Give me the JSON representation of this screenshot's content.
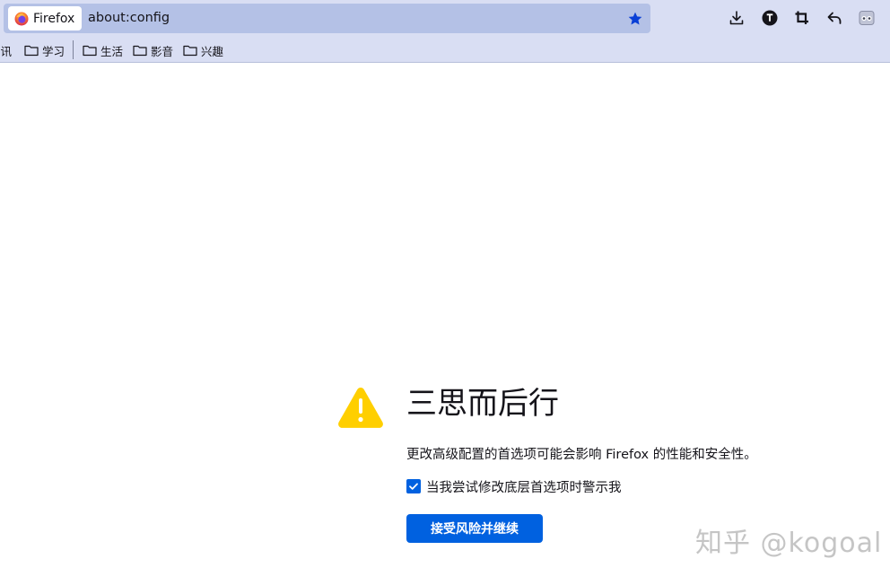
{
  "toolbar": {
    "identity_label": "Firefox",
    "url": "about:config",
    "icons": {
      "browser_logo": "firefox-logo-icon",
      "bookmark_star": "star-filled-icon",
      "downloads": "download-icon",
      "account": "account-t-icon",
      "crop": "crop-icon",
      "undo": "undo-arrow-icon",
      "extension": "extension-icon"
    },
    "colors": {
      "toolbar_bg": "#d9def3",
      "urlbar_bg": "#b4c1e6",
      "star": "#0a3fd6"
    }
  },
  "bookmarks": {
    "items": [
      {
        "label": "资讯",
        "icon": "folder-icon"
      },
      {
        "label": "学习",
        "icon": "folder-icon"
      },
      {
        "label": "生活",
        "icon": "folder-icon"
      },
      {
        "label": "影音",
        "icon": "folder-icon"
      },
      {
        "label": "兴趣",
        "icon": "folder-icon"
      }
    ]
  },
  "warning": {
    "icon": "warning-triangle-icon",
    "title": "三思而后行",
    "description": "更改高级配置的首选项可能会影响 Firefox 的性能和安全性。",
    "checkbox_label": "当我尝试修改底层首选项时警示我",
    "checkbox_checked": true,
    "accept_button": "接受风险并继续",
    "colors": {
      "icon": "#ffcf00",
      "accent": "#0061e0"
    }
  },
  "watermark": "知乎 @kogoal"
}
